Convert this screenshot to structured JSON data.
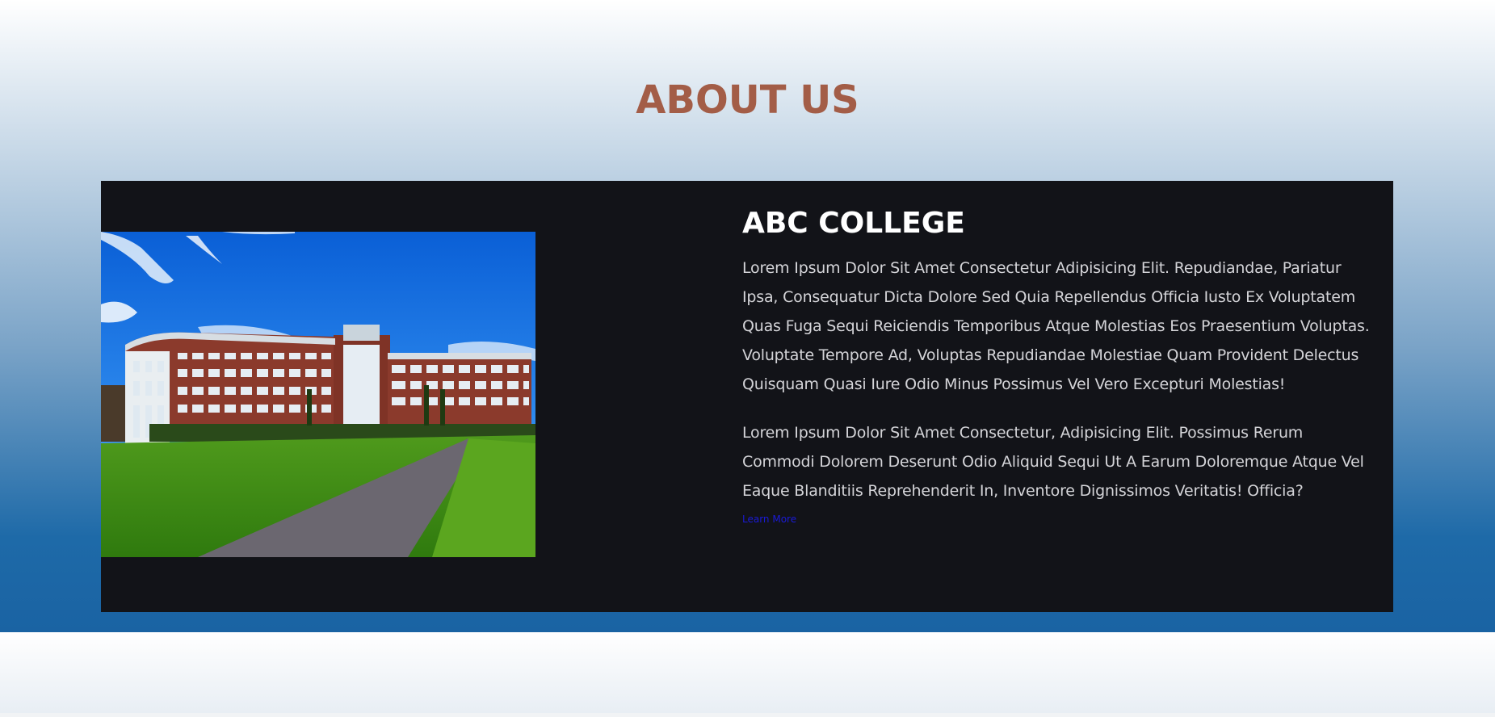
{
  "section": {
    "heading": "ABOUT US",
    "heading_color": "#a35d47"
  },
  "card": {
    "background": "#121318",
    "photo": {
      "alt": "college-building-photo"
    },
    "title": "ABC COLLEGE",
    "paragraphs": [
      "Lorem Ipsum Dolor Sit Amet Consectetur Adipisicing Elit. Repudiandae, Pariatur Ipsa, Consequatur Dicta Dolore Sed Quia Repellendus Officia Iusto Ex Voluptatem Quas Fuga Sequi Reiciendis Temporibus Atque Molestias Eos Praesentium Voluptas. Voluptate Tempore Ad, Voluptas Repudiandae Molestiae Quam Provident Delectus Quisquam Quasi Iure Odio Minus Possimus Vel Vero Excepturi Molestias!",
      "Lorem Ipsum Dolor Sit Amet Consectetur, Adipisicing Elit. Possimus Rerum Commodi Dolorem Deserunt Odio Aliquid Sequi Ut A Earum Doloremque Atque Vel Eaque Blanditiis Reprehenderit In, Inventore Dignissimos Veritatis! Officia?"
    ],
    "link_label": "Learn More"
  }
}
